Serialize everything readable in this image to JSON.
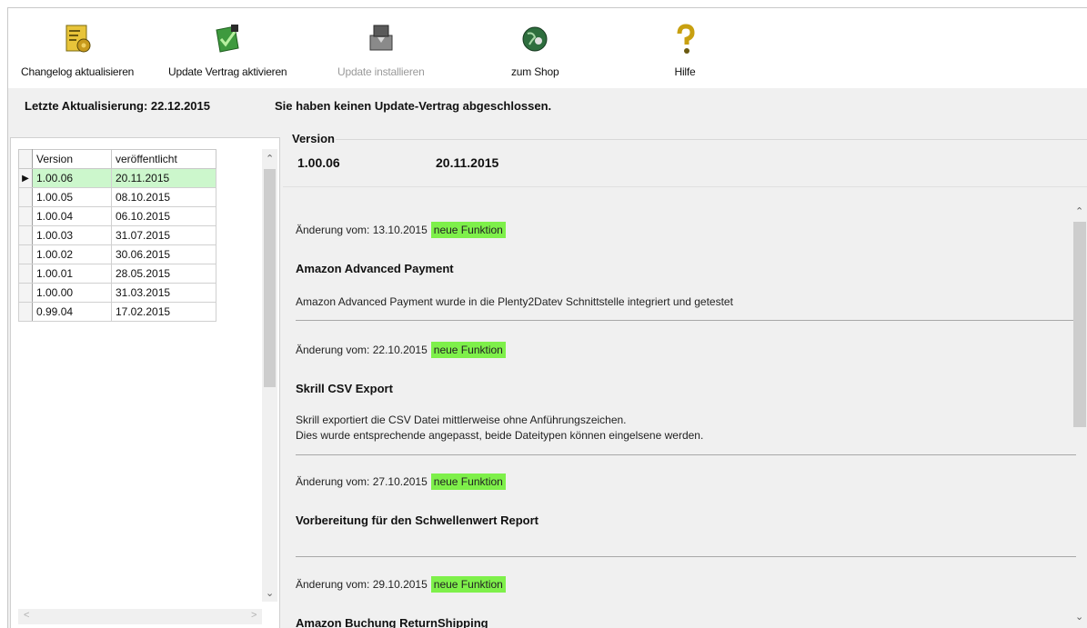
{
  "toolbar": {
    "changelog_label": "Changelog aktualisieren",
    "activate_label": "Update Vertrag aktivieren",
    "install_label": "Update installieren",
    "shop_label": "zum Shop",
    "help_label": "Hilfe"
  },
  "status": {
    "last_update": "Letzte Aktualisierung: 22.12.2015",
    "contract_notice": "Sie haben keinen Update-Vertrag abgeschlossen."
  },
  "versions": {
    "col_version": "Version",
    "col_published": "veröffentlicht",
    "rows": [
      {
        "version": "1.00.06",
        "date": "20.11.2015"
      },
      {
        "version": "1.00.05",
        "date": "08.10.2015"
      },
      {
        "version": "1.00.04",
        "date": "06.10.2015"
      },
      {
        "version": "1.00.03",
        "date": "31.07.2015"
      },
      {
        "version": "1.00.02",
        "date": "30.06.2015"
      },
      {
        "version": "1.00.01",
        "date": "28.05.2015"
      },
      {
        "version": "1.00.00",
        "date": "31.03.2015"
      },
      {
        "version": "0.99.04",
        "date": "17.02.2015"
      }
    ]
  },
  "detail": {
    "group_label": "Version",
    "version": "1.00.06",
    "date": "20.11.2015",
    "entries": [
      {
        "change": "Änderung vom: 13.10.2015",
        "badge": "neue Funktion",
        "title": "Amazon Advanced Payment",
        "desc1": "Amazon Advanced Payment wurde in die Plenty2Datev Schnittstelle integriert und getestet",
        "desc2": ""
      },
      {
        "change": "Änderung vom: 22.10.2015",
        "badge": "neue Funktion",
        "title": "Skrill CSV Export",
        "desc1": "Skrill exportiert die CSV Datei mittlerweise ohne Anführungszeichen.",
        "desc2": "Dies wurde entsprechende angepasst, beide Dateitypen können eingelsene werden."
      },
      {
        "change": "Änderung vom: 27.10.2015",
        "badge": "neue Funktion",
        "title": "Vorbereitung für den Schwellenwert Report",
        "desc1": "",
        "desc2": ""
      },
      {
        "change": "Änderung vom: 29.10.2015",
        "badge": "neue Funktion",
        "title": "Amazon Buchung ReturnShipping",
        "desc1": "",
        "desc2": ""
      }
    ]
  },
  "colors": {
    "badge": "#7ef04a",
    "selected_row": "#ccf7cc"
  }
}
